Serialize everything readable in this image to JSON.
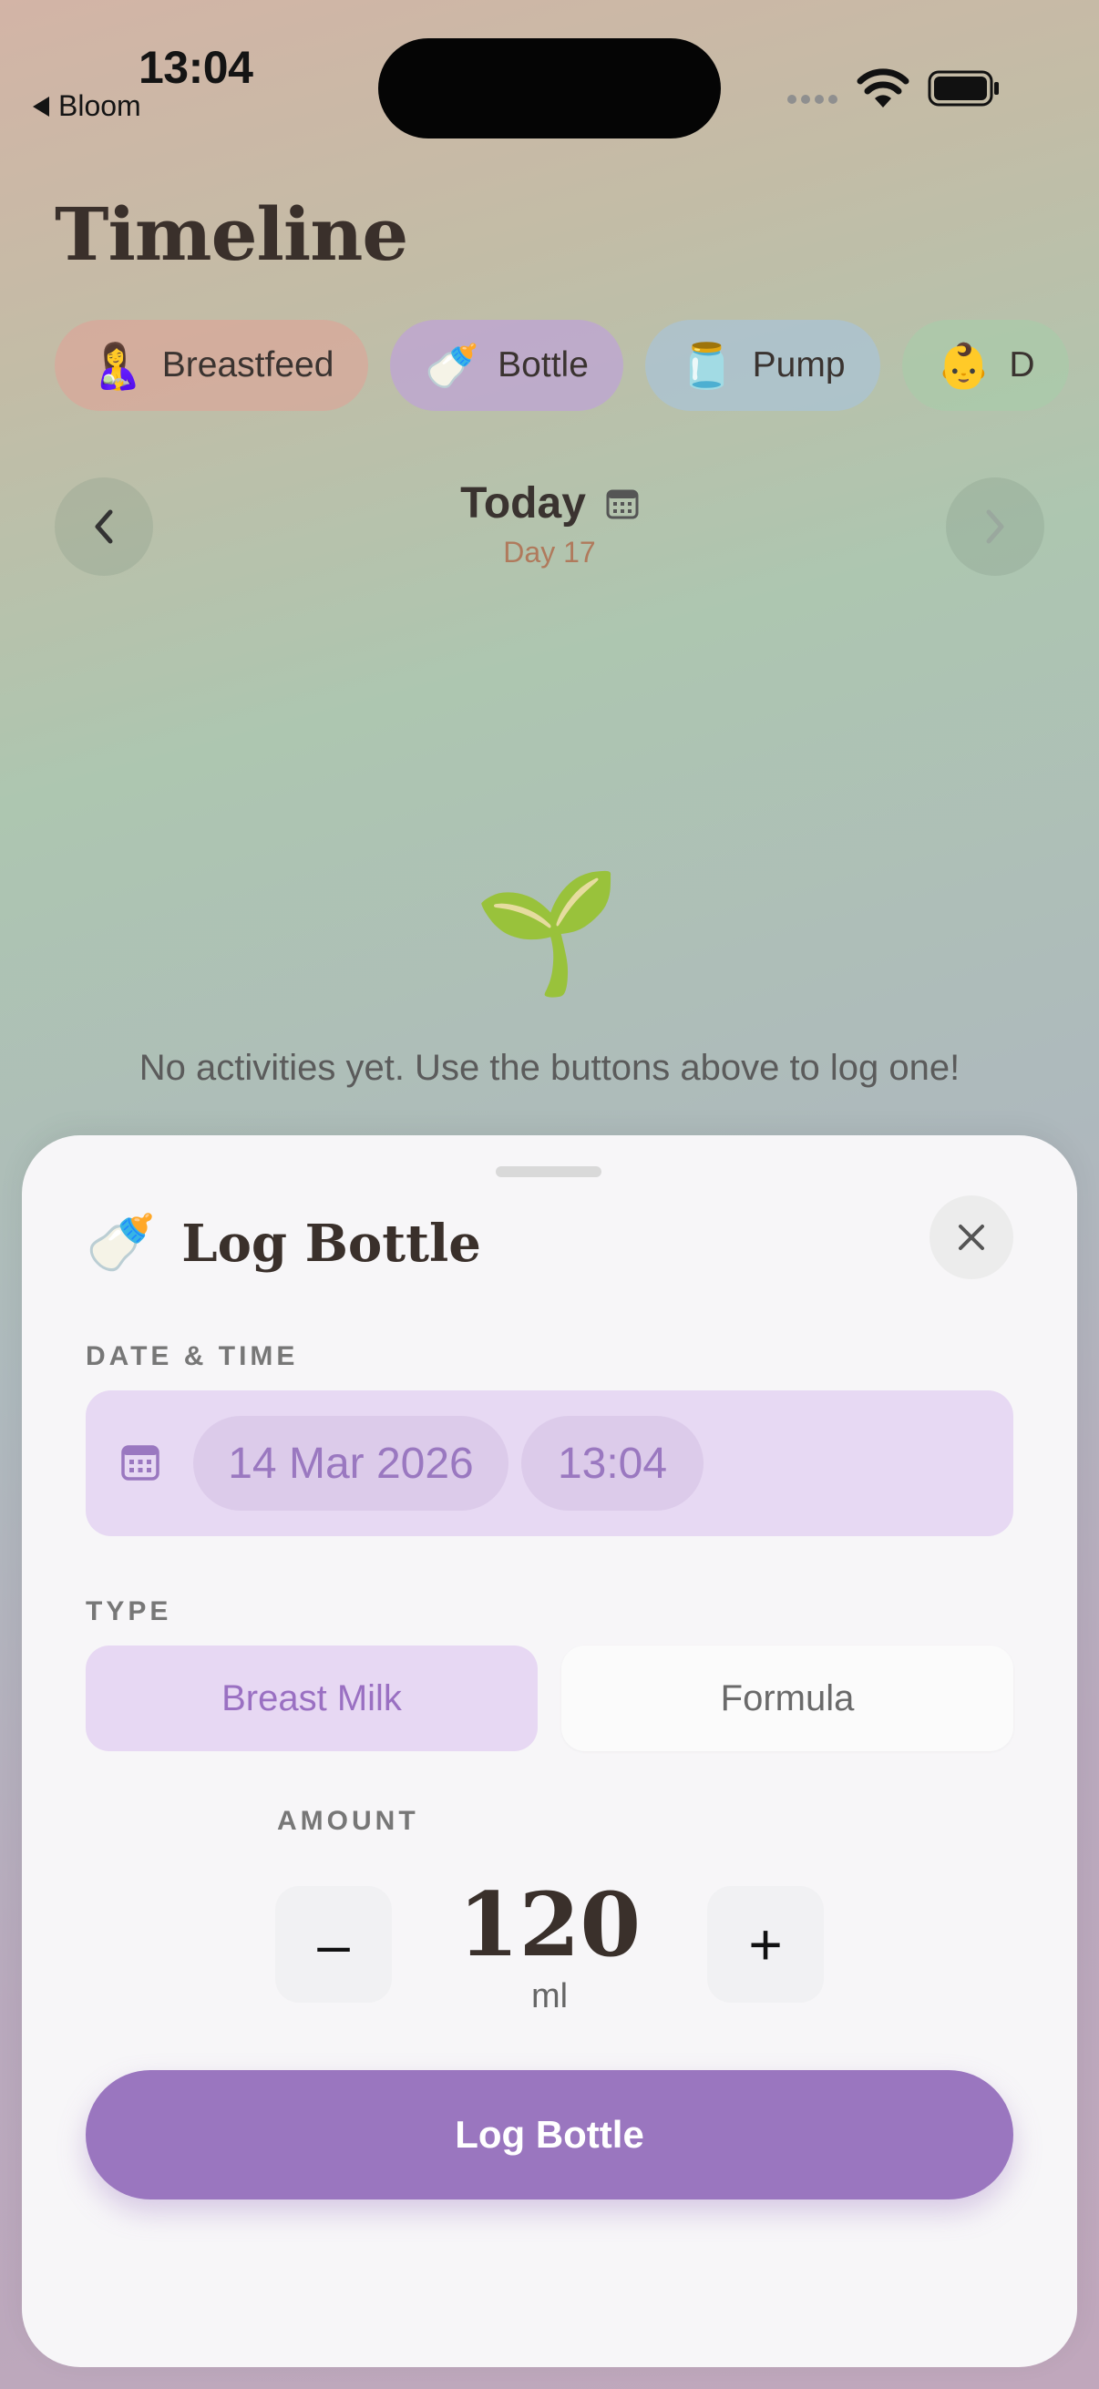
{
  "status": {
    "time": "13:04",
    "back_label": "Bloom"
  },
  "header": {
    "title": "Timeline"
  },
  "quick_actions": [
    {
      "emoji": "🤱",
      "label": "Breastfeed",
      "color": "#e1a096"
    },
    {
      "emoji": "🍼",
      "label": "Bottle",
      "color": "#bea0dc"
    },
    {
      "emoji": "🫙",
      "label": "Pump",
      "color": "#aac3d7"
    },
    {
      "emoji": "👶",
      "label": "D",
      "color": "#a5cdaa"
    }
  ],
  "date_nav": {
    "label": "Today",
    "day": "Day 17"
  },
  "empty_state": {
    "emoji": "🌱",
    "message": "No activities yet. Use the buttons above to log one!"
  },
  "sheet": {
    "emoji": "🍼",
    "title": "Log Bottle",
    "date_time_label": "DATE & TIME",
    "date": "14 Mar 2026",
    "time": "13:04",
    "type_label": "TYPE",
    "type_options": [
      "Breast Milk",
      "Formula"
    ],
    "selected_type": "Breast Milk",
    "amount_label": "AMOUNT",
    "amount_value": "120",
    "amount_unit": "ml",
    "minus_label": "–",
    "plus_label": "+",
    "submit_label": "Log Bottle",
    "accent_color": "#9a76bf"
  }
}
